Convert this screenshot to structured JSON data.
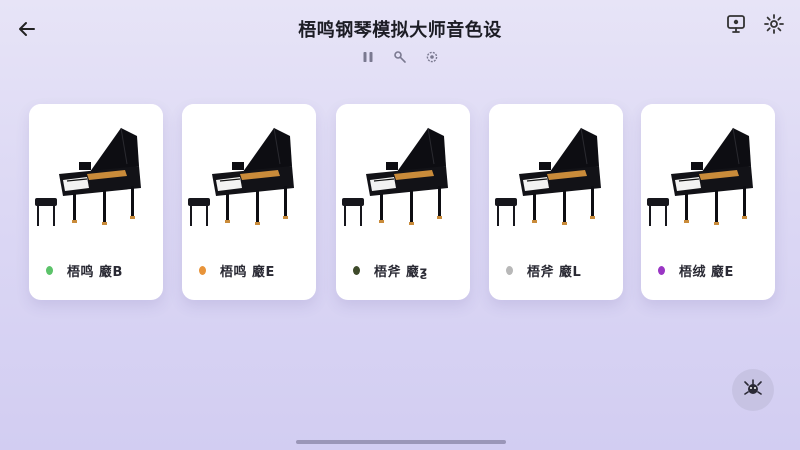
{
  "header": {
    "title": "梧鸣钢琴模拟大师音色设",
    "back_icon": "arrow-left-icon",
    "right_icons": [
      "monitor-icon",
      "gear-icon"
    ],
    "toolbar_icons": [
      "pause-icon",
      "tune-icon",
      "settings-small-icon"
    ]
  },
  "cards": [
    {
      "label": "梧鸣 黀B",
      "dot_color": "#5cc36a",
      "bg": "#ffffff"
    },
    {
      "label": "梧鸣 黀E",
      "dot_color": "#e8943a",
      "bg": "#f4f1ec"
    },
    {
      "label": "梧斧 黀ƺ",
      "dot_color": "#3e4a2a",
      "bg": "#f7f4ee"
    },
    {
      "label": "梧斧 黀L",
      "dot_color": "#b8b8b8",
      "bg": "#e6d7c0"
    },
    {
      "label": "梧绒 黀E",
      "dot_color": "#9a36c4",
      "bg": "#f3eee6"
    }
  ],
  "fab": {
    "icon": "crab-robot-icon"
  },
  "colors": {
    "accent": "#c7c3e3",
    "background": "#dcd8f4"
  }
}
